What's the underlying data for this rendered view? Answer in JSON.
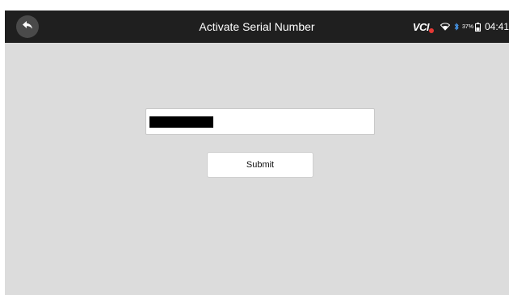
{
  "header": {
    "title": "Activate Serial Number",
    "back_icon": "back-arrow-icon"
  },
  "status_bar": {
    "vci_label": "VCI",
    "battery_percent": "37%",
    "time": "04:41",
    "icons": [
      "vci-disconnected-icon",
      "wifi-icon",
      "bluetooth-icon",
      "battery-icon"
    ]
  },
  "form": {
    "serial_input": {
      "value": "",
      "redacted": true
    },
    "submit_label": "Submit"
  },
  "colors": {
    "titlebar": "#1f1f1f",
    "background": "#dcdcdc",
    "vci_alert": "#e53935"
  }
}
